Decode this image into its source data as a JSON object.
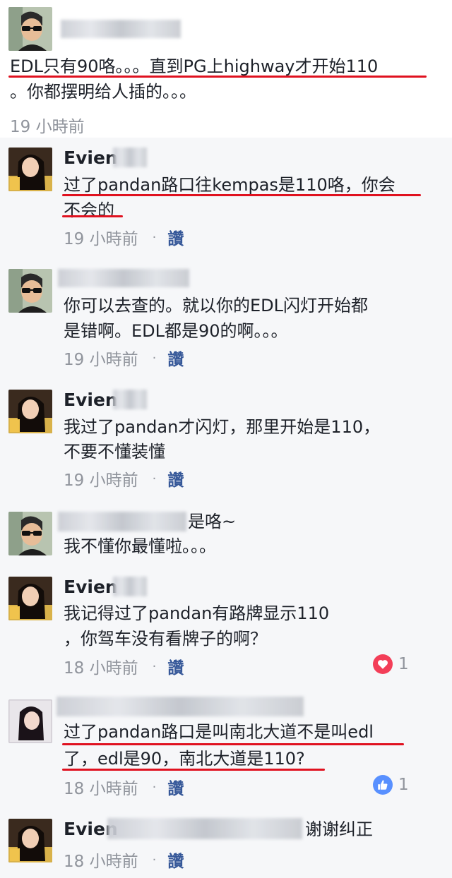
{
  "post": {
    "line1": "EDL只有90咯。。。直到PG上highway才开始110",
    "line2": "。你都摆明给人插的。。。",
    "time": "19 小時前"
  },
  "comments": [
    {
      "author": "Evien",
      "line1": "过了pandan路口往kempas是110咯，你会",
      "line2": "不会的",
      "time": "19 小時前",
      "like": "讚"
    },
    {
      "author": "",
      "line1": "你可以去查的。就以你的EDL闪灯开始都",
      "line2": "是错啊。EDL都是90的啊。。。",
      "time": "19 小時前",
      "like": "讚"
    },
    {
      "author": "Evien",
      "line1": "我过了pandan才闪灯，那里开始是110，",
      "line2": "不要不懂装懂",
      "time": "19 小時前",
      "like": "讚"
    },
    {
      "author": "",
      "inline_text": "是咯~",
      "line2": "我不懂你最懂啦。。。"
    },
    {
      "author": "Evien",
      "line1": "我记得过了pandan有路牌显示110",
      "line2": "，你驾车没有看牌子的啊？",
      "time": "18 小時前",
      "like": "讚",
      "reaction": {
        "type": "love",
        "count": "1",
        "color": "#f33e58"
      }
    },
    {
      "author": "",
      "line1": "过了pandan路口是叫南北大道不是叫edl",
      "line2": "了，edl是90，南北大道是110?",
      "time": "18 小時前",
      "like": "讚",
      "reaction": {
        "type": "like",
        "count": "1",
        "color": "#5890ff"
      }
    },
    {
      "author": "Evien",
      "inline_text": "谢谢纠正",
      "time": "18 小時前",
      "like": "讚"
    }
  ],
  "dot": "·",
  "colors": {
    "underline": "#e0111f",
    "link": "#365899",
    "meta": "#90949c"
  }
}
